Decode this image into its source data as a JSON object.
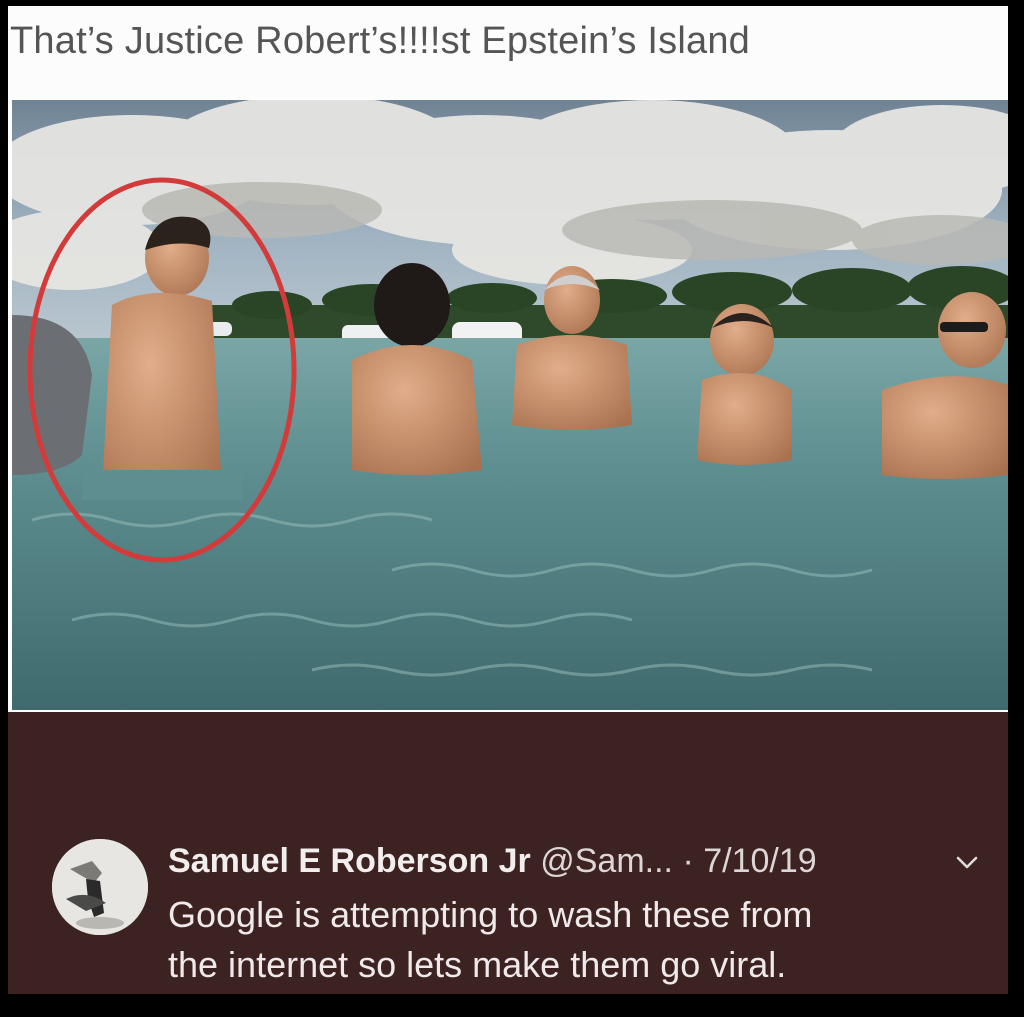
{
  "caption": {
    "text": "That’s Justice Robert’s!!!!st Epstein’s Island"
  },
  "photo": {
    "description_icon": "beach-photo",
    "highlight_color": "#d33b3b"
  },
  "tweet": {
    "name": "Samuel E Roberson Jr",
    "handle": "@Sam...",
    "date": "· 7/10/19",
    "body_lines": [
      "Google is attempting to wash these from",
      "the internet so lets make them go viral."
    ],
    "menu_icon": "chevron-down-icon",
    "avatar_icon": "avatar"
  },
  "colors": {
    "tweet_bg": "#3c2322",
    "caption_text": "#555555",
    "tweet_text": "#efeae9"
  }
}
